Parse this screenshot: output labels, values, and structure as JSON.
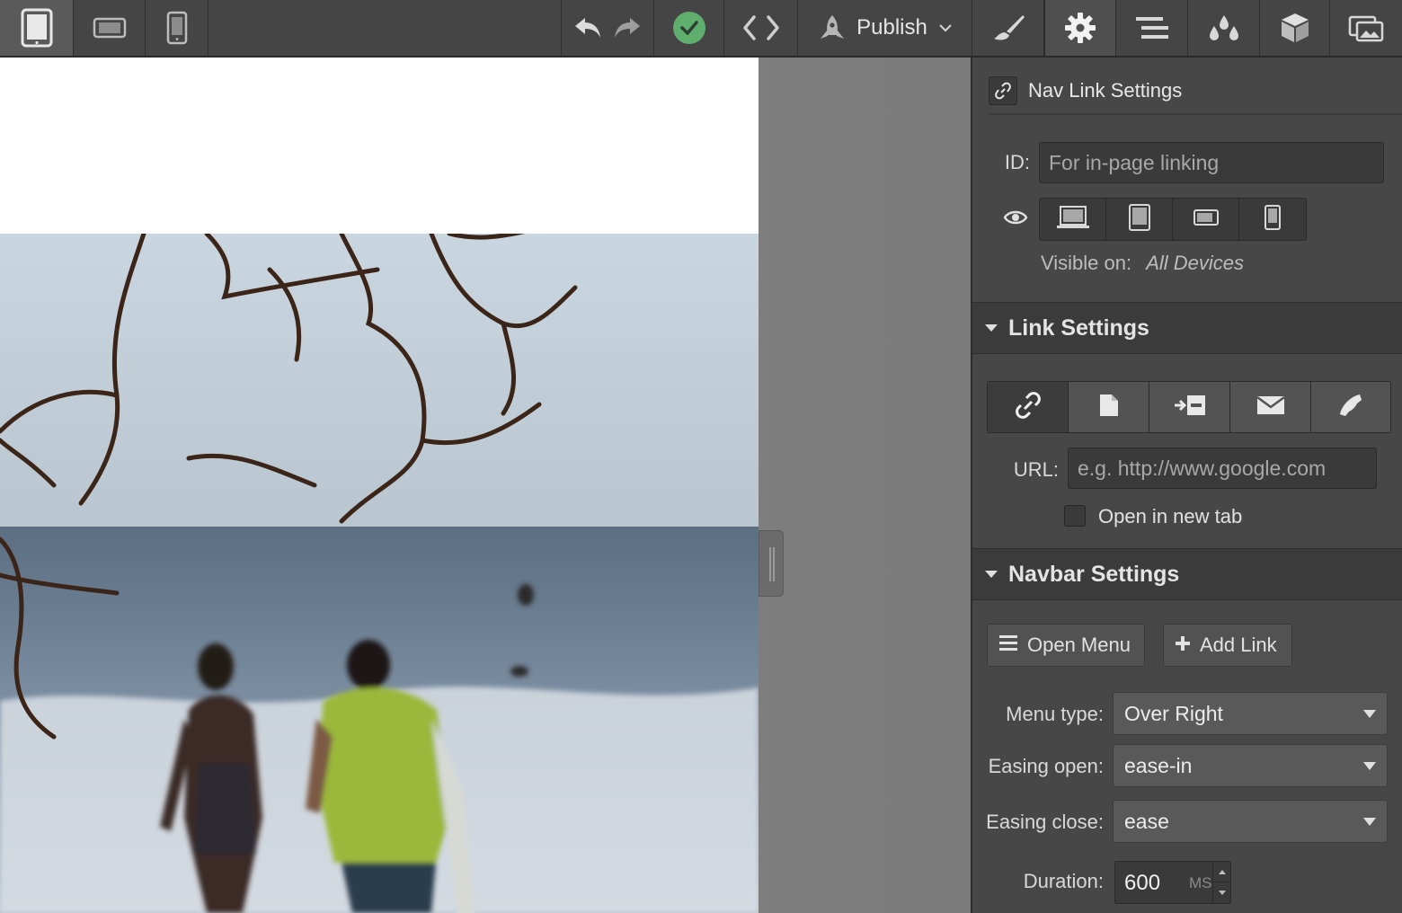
{
  "toolbar": {
    "publish_label": "Publish",
    "icons": [
      "tablet-view-icon",
      "landscape-view-icon",
      "phone-view-icon",
      "undo-icon",
      "redo-icon",
      "checkmark-icon",
      "code-icon",
      "rocket-icon",
      "brush-icon",
      "gear-icon",
      "navigator-icon",
      "drops-icon",
      "cube-icon",
      "assets-icon"
    ],
    "accent_check": "#5fae6e"
  },
  "panel": {
    "header_title": "Nav Link Settings",
    "id_label": "ID:",
    "id_placeholder": "For in-page linking",
    "visible_on_label": "Visible on:",
    "visible_on_value": "All Devices",
    "link_settings": {
      "title": "Link Settings",
      "url_label": "URL:",
      "url_placeholder": "e.g. http://www.google.com",
      "new_tab_label": "Open in new tab",
      "new_tab_checked": false
    },
    "navbar_settings": {
      "title": "Navbar Settings",
      "open_menu_label": "Open Menu",
      "add_link_label": "Add Link",
      "menu_type_label": "Menu type:",
      "menu_type_value": "Over Right",
      "easing_open_label": "Easing open:",
      "easing_open_value": "ease-in",
      "easing_close_label": "Easing close:",
      "easing_close_value": "ease",
      "duration_label": "Duration:",
      "duration_value": "600",
      "duration_unit": "MS"
    }
  }
}
